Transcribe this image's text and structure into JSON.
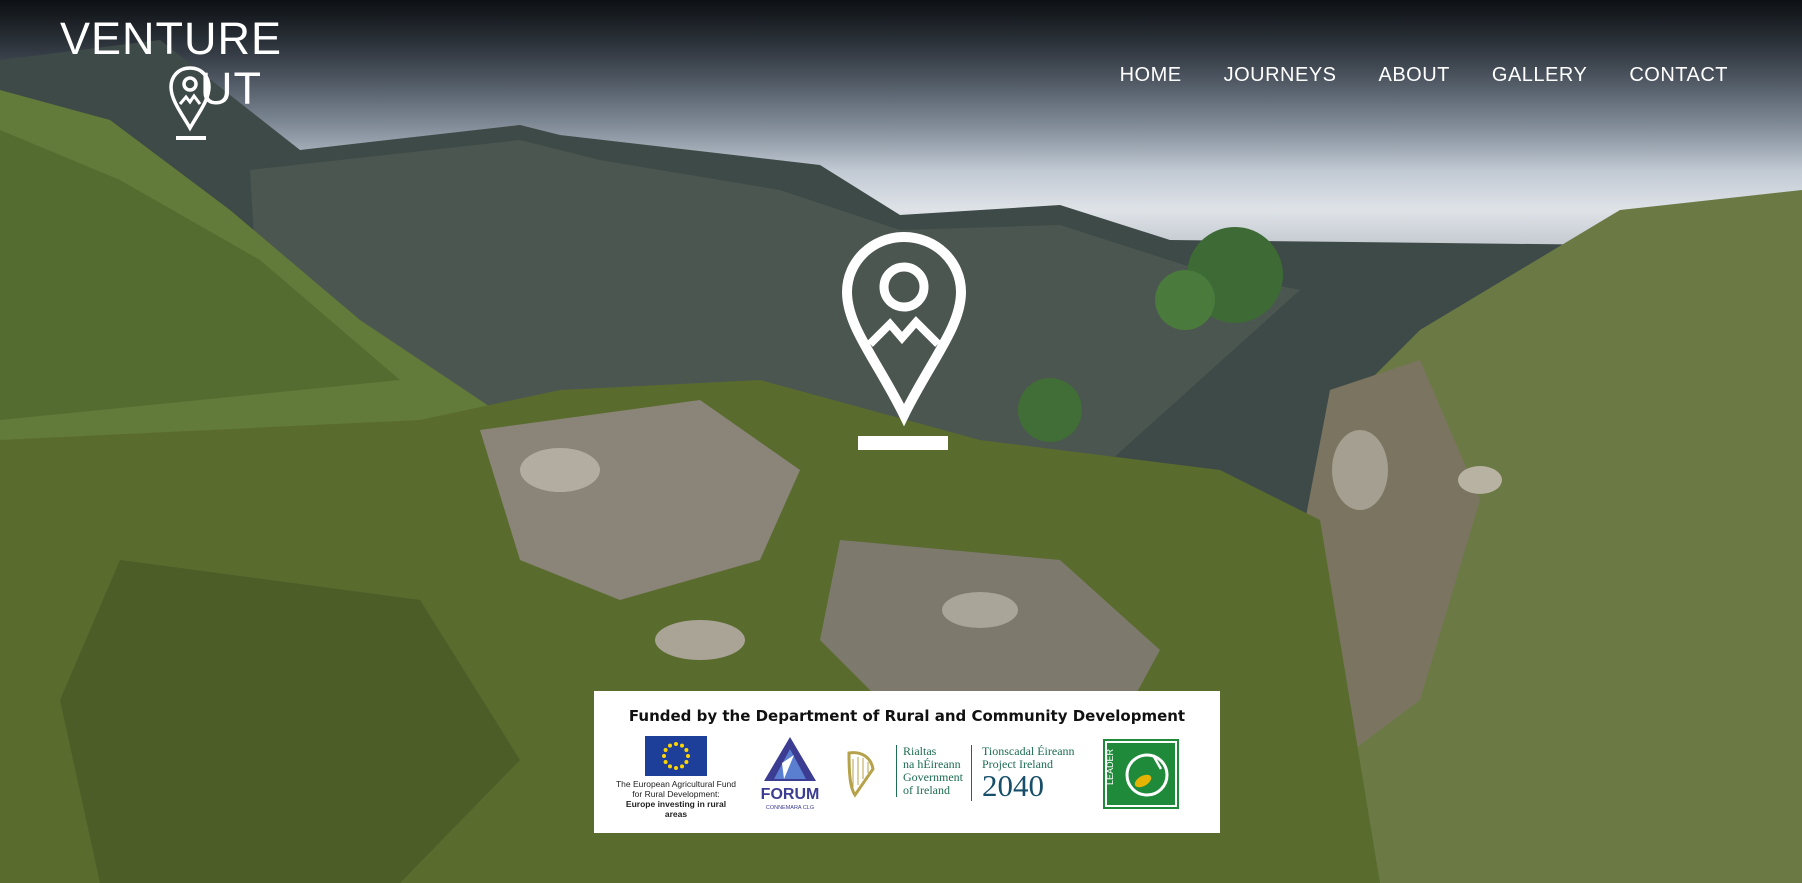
{
  "brand": {
    "line1": "VENTURE",
    "line2": "UT",
    "pin_icon": "map-pin-mountain-icon",
    "color": "#ffffff"
  },
  "nav": {
    "items": [
      {
        "label": "HOME"
      },
      {
        "label": "JOURNEYS"
      },
      {
        "label": "ABOUT"
      },
      {
        "label": "GALLERY"
      },
      {
        "label": "CONTACT"
      }
    ]
  },
  "hero": {
    "center_icon": "map-pin-mountain-icon"
  },
  "funding": {
    "title": "Funded by the Department of Rural and Community Development",
    "eu": {
      "line1": "The European Agricultural Fund",
      "line2": "for Rural Development:",
      "line3": "Europe investing in rural areas"
    },
    "forum": {
      "name": "FORUM",
      "sub": "CONNEMARA CLG"
    },
    "gov": {
      "l1": "Rialtas",
      "l2": "na hÉireann",
      "l3": "Government",
      "l4": "of Ireland"
    },
    "project_ireland": {
      "l1": "Tionscadal Éireann",
      "l2": "Project Ireland",
      "year": "2040"
    },
    "leader": {
      "text": "LEADER"
    }
  },
  "colors": {
    "gov_green": "#1d6d52",
    "eu_blue": "#1d3f9a",
    "leader_green": "#1f8a3a"
  }
}
